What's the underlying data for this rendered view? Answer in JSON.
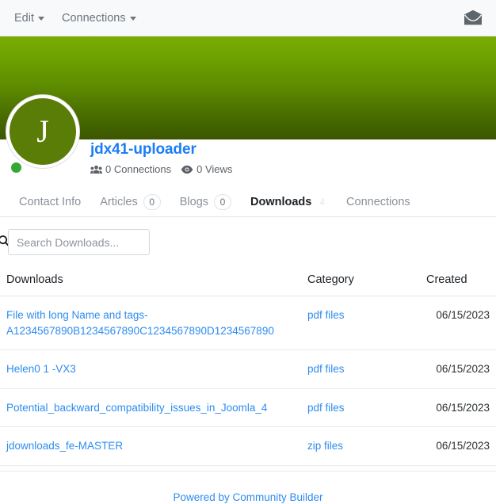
{
  "toolbar": {
    "menus": [
      {
        "label": "Edit",
        "icon": "chevron-down-icon"
      },
      {
        "label": "Connections",
        "icon": "chevron-down-icon"
      }
    ],
    "messages_icon": "envelope-icon"
  },
  "profile": {
    "avatar_initial": "J",
    "status": "online",
    "username": "jdx41-uploader",
    "stats": [
      {
        "icon": "users-icon",
        "label": "0 Connections"
      },
      {
        "icon": "eye-icon",
        "label": "0 Views"
      }
    ]
  },
  "tabs": [
    {
      "label": "Contact Info",
      "badge": null,
      "active": false
    },
    {
      "label": "Articles",
      "badge": "0",
      "active": false
    },
    {
      "label": "Blogs",
      "badge": "0",
      "active": false
    },
    {
      "label": "Downloads",
      "badge": "4",
      "active": true
    },
    {
      "label": "Connections",
      "badge": null,
      "active": false
    }
  ],
  "search": {
    "icon": "search-icon",
    "value": "",
    "placeholder": "Search Downloads..."
  },
  "table": {
    "columns": [
      "Downloads",
      "Category",
      "Created"
    ],
    "rows": [
      {
        "name": "File with long Name and tags-A1234567890B1234567890C1234567890D1234567890",
        "category": "pdf files",
        "created": "06/15/2023"
      },
      {
        "name": "Helen0 1 -VX3",
        "category": "pdf files",
        "created": "06/15/2023"
      },
      {
        "name": "Potential_backward_compatibility_issues_in_Joomla_4",
        "category": "pdf files",
        "created": "06/15/2023"
      },
      {
        "name": "jdownloads_fe-MASTER",
        "category": "zip files",
        "created": "06/15/2023"
      }
    ]
  },
  "footer": {
    "text": "Powered by Community Builder"
  },
  "colors": {
    "link": "#2d8cf0",
    "username": "#1a7df5",
    "banner_top": "#79ad00",
    "banner_bottom": "#3b5600",
    "avatar": "#5a7d08",
    "status_online": "#35a735"
  }
}
